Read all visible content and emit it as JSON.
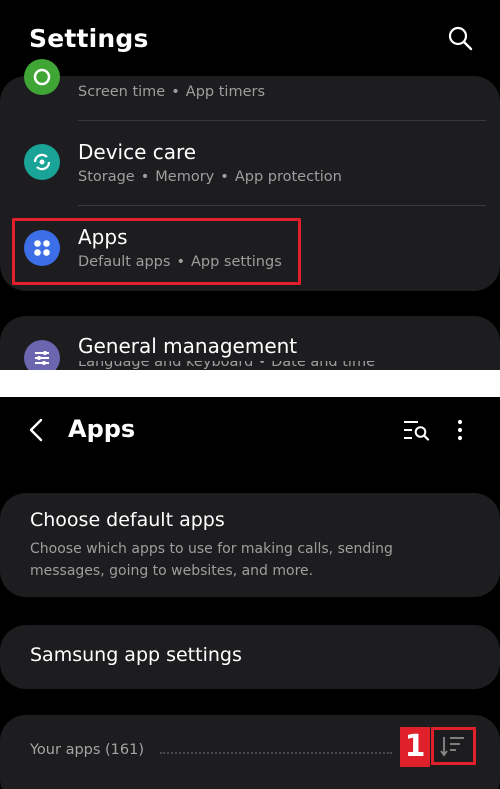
{
  "settings_screen": {
    "title": "Settings",
    "partial_item": {
      "subtitle_parts": [
        "Screen time",
        "App timers"
      ]
    },
    "items": [
      {
        "title": "Device care",
        "subtitle_parts": [
          "Storage",
          "Memory",
          "App protection"
        ]
      },
      {
        "title": "Apps",
        "subtitle_parts": [
          "Default apps",
          "App settings"
        ]
      }
    ],
    "general": {
      "title": "General management",
      "clipped_subtitle": "Language and keyboard  •  Date and time"
    },
    "colors": {
      "digital_wellbeing_icon": "#3fa535",
      "device_care_icon": "#1aa397",
      "apps_icon": "#3c6ee8",
      "general_icon": "#6c65b0",
      "highlight": "#e0202a"
    }
  },
  "apps_screen": {
    "title": "Apps",
    "choose_default": {
      "title": "Choose default apps",
      "description": "Choose which apps to use for making calls, sending messages, going to websites, and more."
    },
    "samsung_settings": {
      "title": "Samsung app settings"
    },
    "your_apps": {
      "label": "Your apps (161)"
    },
    "annotation_number": "1"
  }
}
